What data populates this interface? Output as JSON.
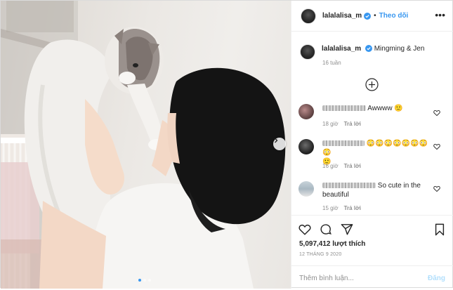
{
  "post": {
    "author": "lalalalisa_m",
    "follow_label": "Theo dõi",
    "separator": "•",
    "more_label": "•••"
  },
  "caption": {
    "username": "lalalalisa_m",
    "text": "Mingming & Jen",
    "time": "16 tuần"
  },
  "comments": [
    {
      "text": "Awwww 🙂",
      "time": "18 giờ",
      "reply_label": "Trả lời"
    },
    {
      "text": "😳😳😳😳😳😳😳😳",
      "text2": "🙂",
      "time": "16 giờ",
      "reply_label": "Trả lời"
    },
    {
      "text": "So cute in the",
      "text2": "beautiful",
      "time": "15 giờ",
      "reply_label": "Trả lời"
    }
  ],
  "likes": "5,097,412 lượt thích",
  "date": "12 THÁNG 9 2020",
  "add_comment": {
    "placeholder": "Thêm bình luận...",
    "post_label": "Đăng"
  },
  "carousel": {
    "slides": 3,
    "active": 1
  },
  "colors": {
    "accent": "#3897f0",
    "text": "#262626",
    "muted": "#8e8e8e",
    "post_disabled": "#b2dffc"
  }
}
